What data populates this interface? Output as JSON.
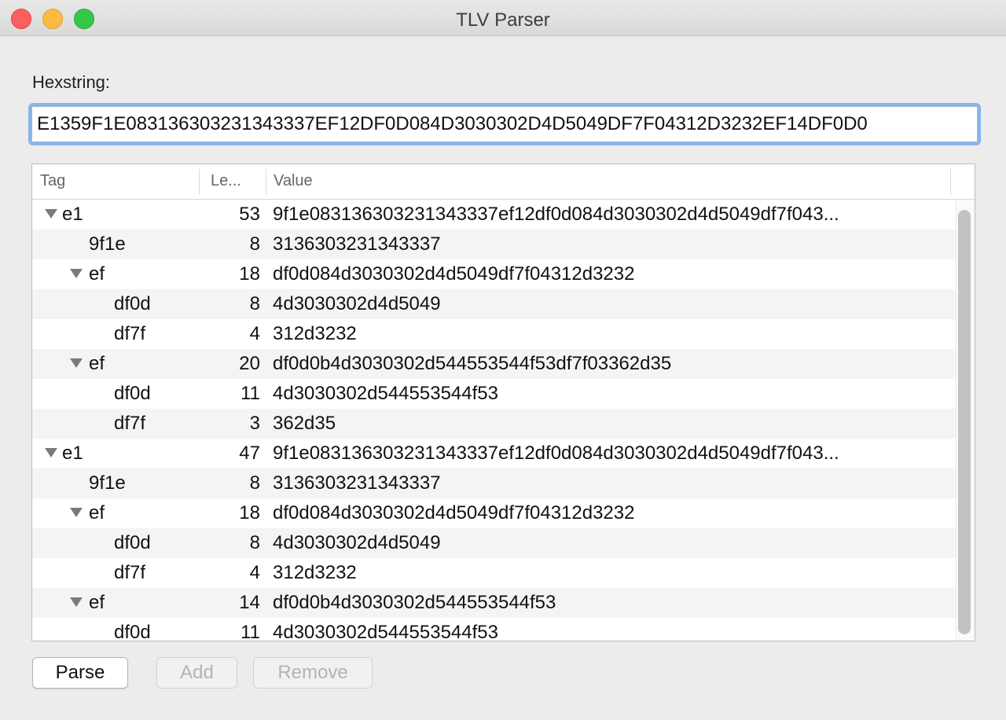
{
  "window": {
    "title": "TLV Parser"
  },
  "hexstring": {
    "label": "Hexstring:",
    "value": "E1359F1E083136303231343337EF12DF0D084D3030302D4D5049DF7F04312D3232EF14DF0D0"
  },
  "table": {
    "columns": {
      "tag": "Tag",
      "length": "Le...",
      "value": "Value"
    },
    "rows": [
      {
        "tag": "e1",
        "length": "53",
        "value": "9f1e083136303231343337ef12df0d084d3030302d4d5049df7f043...",
        "depth": 0,
        "expanded": true
      },
      {
        "tag": "9f1e",
        "length": "8",
        "value": "3136303231343337",
        "depth": 1,
        "expanded": false
      },
      {
        "tag": "ef",
        "length": "18",
        "value": "df0d084d3030302d4d5049df7f04312d3232",
        "depth": 1,
        "expanded": true
      },
      {
        "tag": "df0d",
        "length": "8",
        "value": "4d3030302d4d5049",
        "depth": 2,
        "expanded": false
      },
      {
        "tag": "df7f",
        "length": "4",
        "value": "312d3232",
        "depth": 2,
        "expanded": false
      },
      {
        "tag": "ef",
        "length": "20",
        "value": "df0d0b4d3030302d544553544f53df7f03362d35",
        "depth": 1,
        "expanded": true
      },
      {
        "tag": "df0d",
        "length": "11",
        "value": "4d3030302d544553544f53",
        "depth": 2,
        "expanded": false
      },
      {
        "tag": "df7f",
        "length": "3",
        "value": "362d35",
        "depth": 2,
        "expanded": false
      },
      {
        "tag": "e1",
        "length": "47",
        "value": "9f1e083136303231343337ef12df0d084d3030302d4d5049df7f043...",
        "depth": 0,
        "expanded": true
      },
      {
        "tag": "9f1e",
        "length": "8",
        "value": "3136303231343337",
        "depth": 1,
        "expanded": false
      },
      {
        "tag": "ef",
        "length": "18",
        "value": "df0d084d3030302d4d5049df7f04312d3232",
        "depth": 1,
        "expanded": true
      },
      {
        "tag": "df0d",
        "length": "8",
        "value": "4d3030302d4d5049",
        "depth": 2,
        "expanded": false
      },
      {
        "tag": "df7f",
        "length": "4",
        "value": "312d3232",
        "depth": 2,
        "expanded": false
      },
      {
        "tag": "ef",
        "length": "14",
        "value": "df0d0b4d3030302d544553544f53",
        "depth": 1,
        "expanded": true
      },
      {
        "tag": "df0d",
        "length": "11",
        "value": "4d3030302d544553544f53",
        "depth": 2,
        "expanded": false
      }
    ]
  },
  "buttons": {
    "parse": "Parse",
    "add": "Add",
    "remove": "Remove"
  }
}
